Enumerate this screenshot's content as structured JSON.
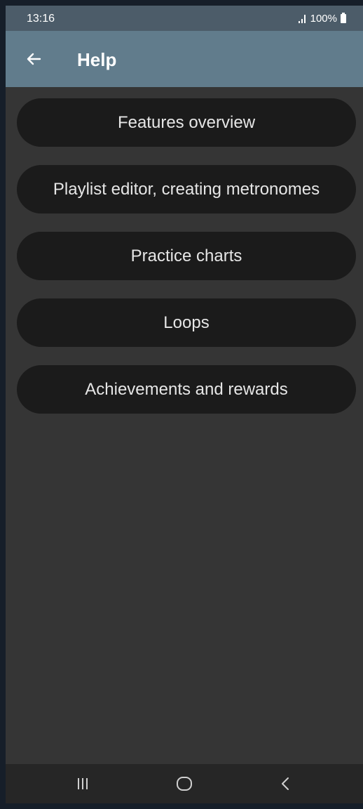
{
  "status_bar": {
    "time": "13:16",
    "battery": "100%",
    "icons": [
      "signal-icon",
      "battery-icon"
    ]
  },
  "app_bar": {
    "title": "Help",
    "back_icon": "arrow-left-icon",
    "color": "#617c8c"
  },
  "help_items": [
    {
      "label": "Features overview"
    },
    {
      "label": "Playlist editor, creating metronomes"
    },
    {
      "label": "Practice charts"
    },
    {
      "label": "Loops"
    },
    {
      "label": "Achievements and rewards"
    }
  ],
  "nav_bar": {
    "icons": [
      "recent-apps-icon",
      "home-icon",
      "back-icon"
    ]
  },
  "colors": {
    "background": "#353535",
    "item_background": "#1b1b1b",
    "text": "#e6e6e6"
  }
}
